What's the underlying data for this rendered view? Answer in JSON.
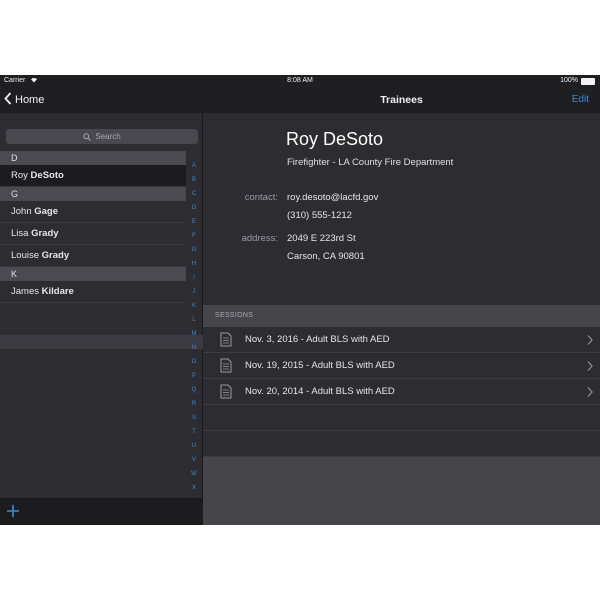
{
  "status_bar": {
    "carrier": "Carrier",
    "time": "8:08 AM",
    "battery": "100%"
  },
  "left_nav": {
    "back_label": "Home"
  },
  "search": {
    "placeholder": "Search"
  },
  "list": {
    "sections": [
      {
        "letter": "D",
        "rows": [
          {
            "first": "Roy",
            "last": "DeSoto",
            "selected": true
          }
        ]
      },
      {
        "letter": "G",
        "rows": [
          {
            "first": "John",
            "last": "Gage"
          },
          {
            "first": "Lisa",
            "last": "Grady"
          },
          {
            "first": "Louise",
            "last": "Grady"
          }
        ]
      },
      {
        "letter": "K",
        "rows": [
          {
            "first": "James",
            "last": "Kildare"
          }
        ]
      }
    ]
  },
  "index_letters": [
    "A",
    "B",
    "C",
    "D",
    "E",
    "F",
    "G",
    "H",
    "I",
    "J",
    "K",
    "L",
    "M",
    "N",
    "O",
    "P",
    "Q",
    "R",
    "S",
    "T",
    "U",
    "V",
    "W",
    "X",
    "Y"
  ],
  "right_nav": {
    "title": "Trainees",
    "edit_label": "Edit"
  },
  "contact": {
    "name": "Roy DeSoto",
    "title": "Firefighter - LA County Fire Department",
    "contact_label": "contact:",
    "email": "roy.desoto@lacfd.gov",
    "phone": "(310) 555-1212",
    "address_label": "address:",
    "address_line1": "2049 E 223rd St",
    "address_line2": "Carson, CA 90801"
  },
  "sessions": {
    "header": "SESSIONS",
    "items": [
      "Nov. 3, 2016 - Adult BLS with AED",
      "Nov. 19, 2015 - Adult BLS with AED",
      "Nov. 20, 2014 - Adult BLS with AED"
    ]
  },
  "colors": {
    "accent": "#3a8bd6",
    "background": "#2c2c31",
    "bar": "#1f1f22"
  }
}
